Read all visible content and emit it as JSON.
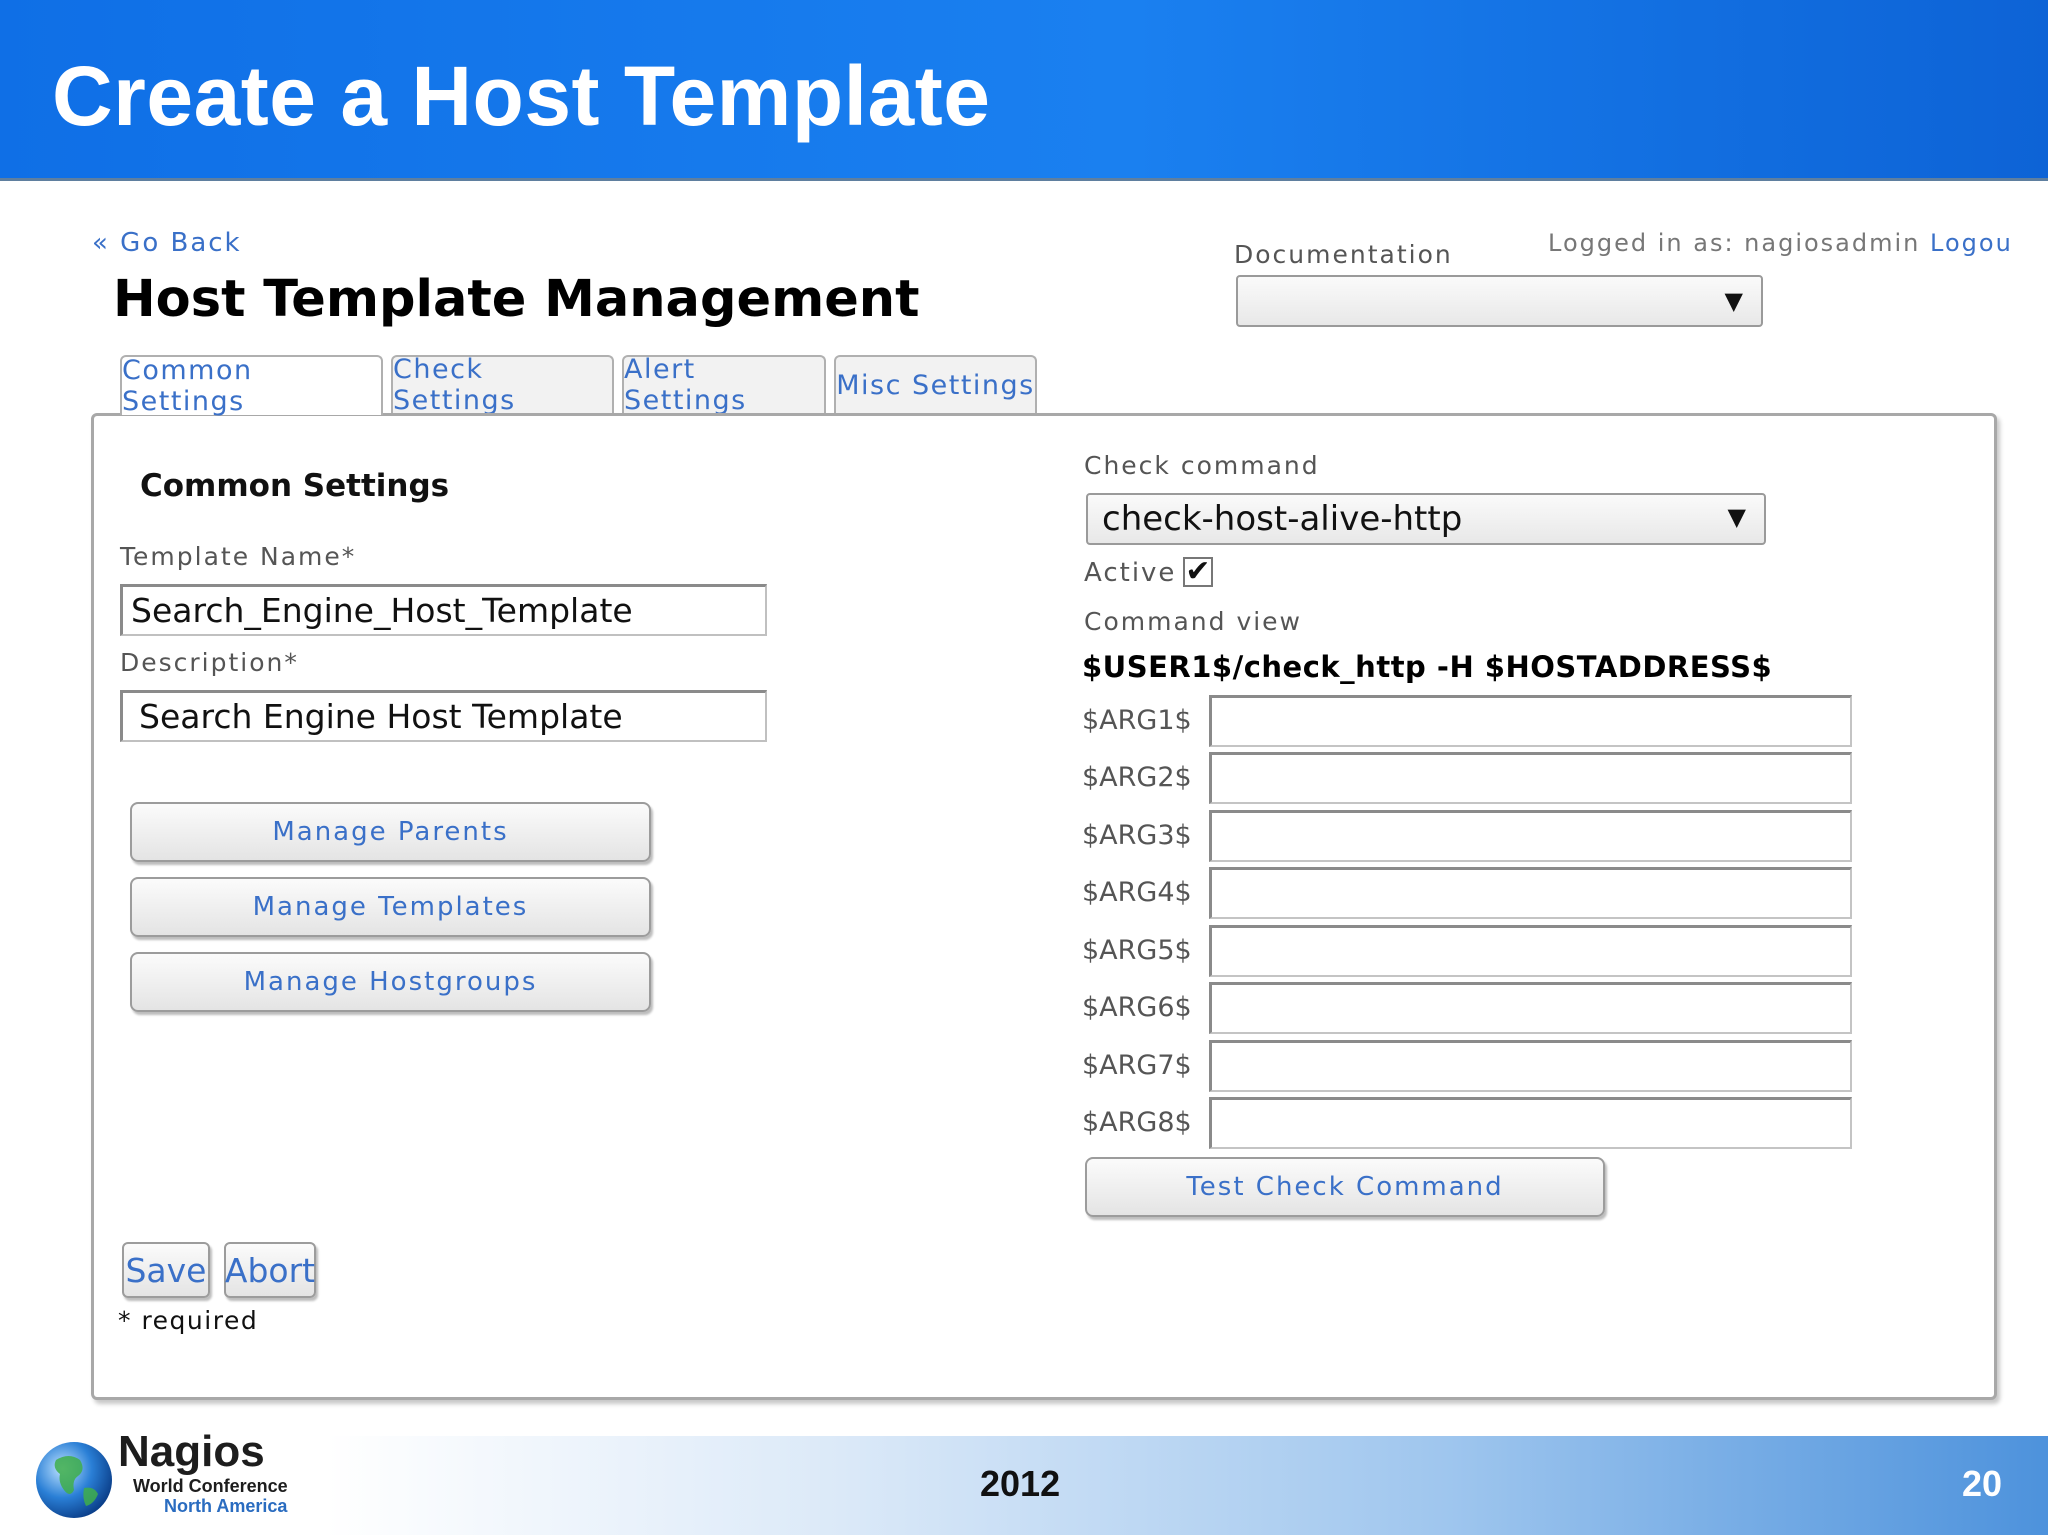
{
  "slide": {
    "title": "Create a Host Template",
    "year": "2012",
    "page_number": "20",
    "logo": {
      "name": "Nagios",
      "line1": "World Conference",
      "line2": "North America"
    }
  },
  "nav": {
    "go_back": "« Go Back",
    "logged_in_text": "Logged in as: nagiosadmin",
    "logout": "Logou"
  },
  "page_title": "Host Template Management",
  "documentation": {
    "label": "Documentation",
    "value": ""
  },
  "tabs": [
    {
      "label": "Common Settings",
      "active": true
    },
    {
      "label": "Check Settings",
      "active": false
    },
    {
      "label": "Alert Settings",
      "active": false
    },
    {
      "label": "Misc Settings",
      "active": false
    }
  ],
  "common": {
    "section_title": "Common Settings",
    "template_name_label": "Template Name*",
    "template_name_value": "Search_Engine_Host_Template",
    "description_label": "Description*",
    "description_value": "Search Engine Host Template",
    "buttons": {
      "manage_parents": "Manage Parents",
      "manage_templates": "Manage Templates",
      "manage_hostgroups": "Manage Hostgroups"
    },
    "save": "Save",
    "abort": "Abort",
    "required_note": "* required"
  },
  "check": {
    "label": "Check command",
    "selected": "check-host-alive-http",
    "active_label": "Active",
    "active_checked": true,
    "check_mark": "✔",
    "command_view_label": "Command view",
    "command_view": "$USER1$/check_http -H $HOSTADDRESS$",
    "args": [
      "$ARG1$",
      "$ARG2$",
      "$ARG3$",
      "$ARG4$",
      "$ARG5$",
      "$ARG6$",
      "$ARG7$",
      "$ARG8$"
    ],
    "test_button": "Test Check Command"
  },
  "icons": {
    "dropdown": "▼"
  }
}
